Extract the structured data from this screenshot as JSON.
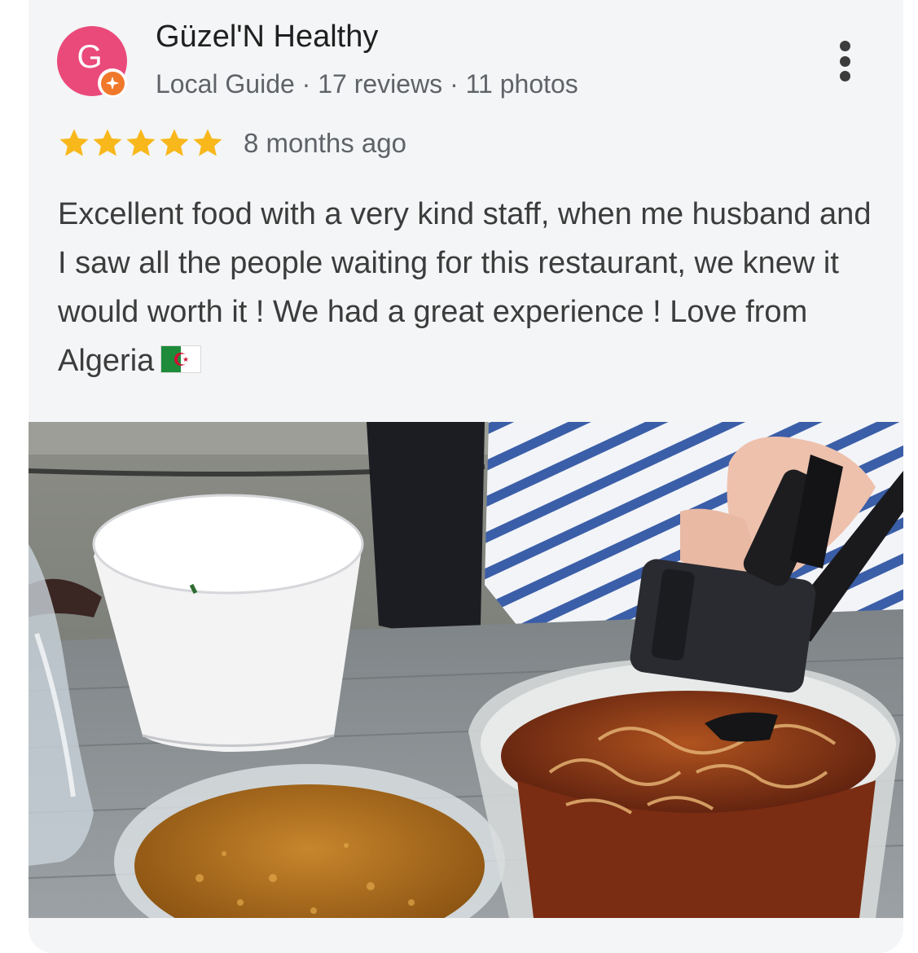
{
  "review": {
    "author": {
      "initial": "G",
      "name": "Güzel'N Healthy",
      "meta": "Local Guide · 17 reviews · 11 photos",
      "avatar_color": "#ea4a7a",
      "badge_color": "#f0782a"
    },
    "rating": {
      "stars": 5,
      "max": 5,
      "star_color": "#f8b81c"
    },
    "time_ago": "8 months ago",
    "text": "Excellent food with a very kind staff, when me husband and I saw all the people waiting for this restaurant, we knew it would worth it ! We had a great experience ! Love from Algeria",
    "flag_icon": "algeria-flag-icon",
    "menu_icon": "more-vert-icon"
  },
  "photo": {
    "icon": "review-photo"
  }
}
